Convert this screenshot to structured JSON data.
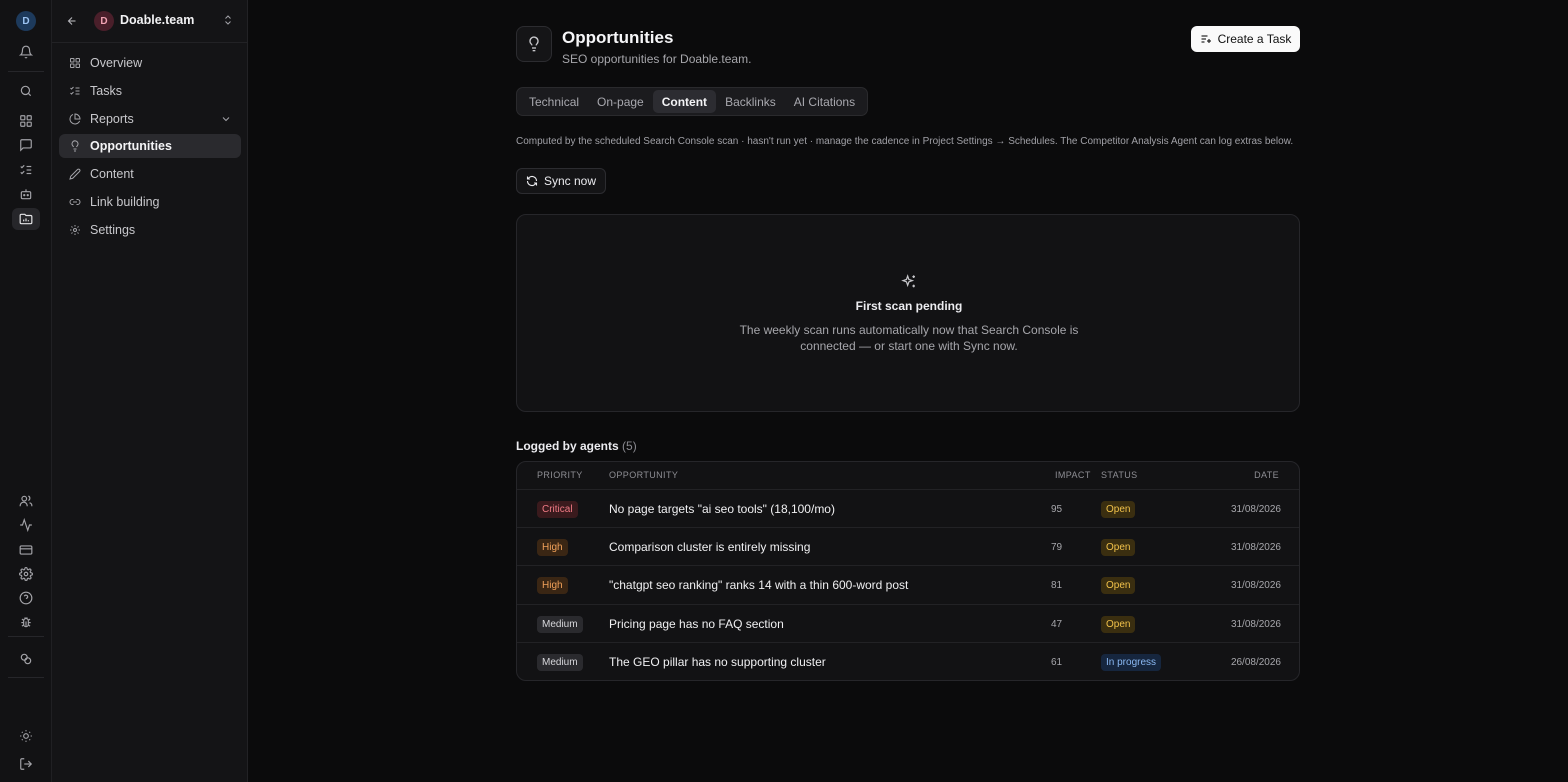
{
  "rail": {
    "avatar_initial": "D"
  },
  "workspace": {
    "initial": "D",
    "name": "Doable.team"
  },
  "nav": [
    {
      "label": "Overview",
      "icon": "grid-icon"
    },
    {
      "label": "Tasks",
      "icon": "checklist-icon"
    },
    {
      "label": "Reports",
      "icon": "pie-chart-icon"
    },
    {
      "label": "Opportunities",
      "icon": "lightbulb-icon",
      "active": true
    },
    {
      "label": "Content",
      "icon": "pencil-icon"
    },
    {
      "label": "Link building",
      "icon": "link-icon"
    },
    {
      "label": "Settings",
      "icon": "gear-icon"
    }
  ],
  "page": {
    "title": "Opportunities",
    "subtitle": "SEO opportunities for Doable.team.",
    "create_task_label": "Create a Task"
  },
  "tabs": [
    "Technical",
    "On-page",
    "Content",
    "Backlinks",
    "AI Citations"
  ],
  "active_tab": "Content",
  "note": "Computed by the scheduled Search Console scan · hasn't run yet · manage the cadence in Project Settings → Schedules. The Competitor Analysis Agent can log extras below.",
  "sync_label": "Sync now",
  "empty_state": {
    "title": "First scan pending",
    "text": "The weekly scan runs automatically now that Search Console is connected — or start one with Sync now."
  },
  "logged": {
    "title": "Logged by agents",
    "count": "(5)",
    "headers": {
      "priority": "PRIORITY",
      "opportunity": "OPPORTUNITY",
      "impact": "IMPACT",
      "status": "STATUS",
      "date": "DATE"
    },
    "rows": [
      {
        "priority": "Critical",
        "opportunity": "No page targets \"ai seo tools\" (18,100/mo)",
        "impact": "95",
        "status": "Open",
        "date": "31/08/2026"
      },
      {
        "priority": "High",
        "opportunity": "Comparison cluster is entirely missing",
        "impact": "79",
        "status": "Open",
        "date": "31/08/2026"
      },
      {
        "priority": "High",
        "opportunity": "\"chatgpt seo ranking\" ranks 14 with a thin 600-word post",
        "impact": "81",
        "status": "Open",
        "date": "31/08/2026"
      },
      {
        "priority": "Medium",
        "opportunity": "Pricing page has no FAQ section",
        "impact": "47",
        "status": "Open",
        "date": "31/08/2026"
      },
      {
        "priority": "Medium",
        "opportunity": "The GEO pillar has no supporting cluster",
        "impact": "61",
        "status": "In progress",
        "date": "26/08/2026"
      }
    ]
  },
  "colors": {
    "background": "#0b0b0c",
    "critical": "#f07a85",
    "high": "#f2a25a",
    "open": "#f2c24a",
    "in_progress": "#8ab8f2"
  }
}
